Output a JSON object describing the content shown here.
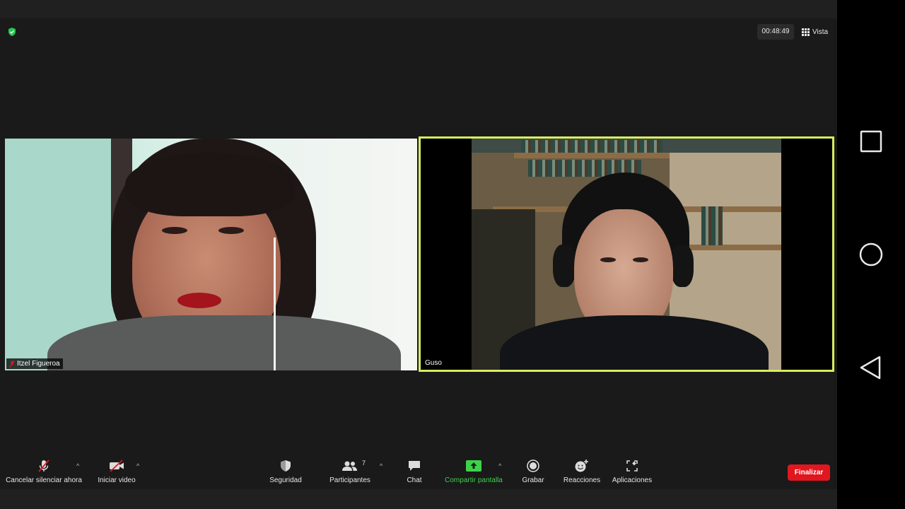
{
  "meeting": {
    "timer": "00:48:49",
    "view_label": "Vista"
  },
  "participants": {
    "left_name": "Itzel Figueroa",
    "right_name": "Guso",
    "active_speaker_color": "#d9ec5f"
  },
  "toolbar": {
    "mute_label": "Cancelar silenciar ahora",
    "video_label": "Iniciar video",
    "security_label": "Seguridad",
    "participants_label": "Participantes",
    "participants_count": "7",
    "chat_label": "Chat",
    "share_label": "Compartir pantalla",
    "record_label": "Grabar",
    "reactions_label": "Reacciones",
    "apps_label": "Aplicaciones",
    "end_label": "Finalizar",
    "caret": "^"
  },
  "colors": {
    "share_accent": "#3fd14b",
    "end_button": "#e0171f",
    "muted_red": "#e0171f"
  },
  "android_nav": {
    "icons": [
      "recents-square-icon",
      "home-circle-icon",
      "back-triangle-icon"
    ]
  }
}
